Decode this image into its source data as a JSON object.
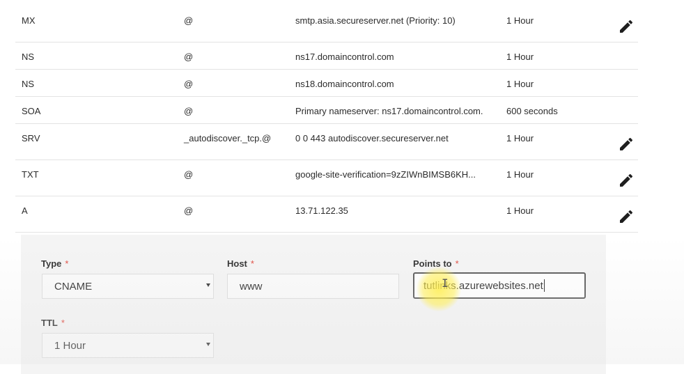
{
  "records": [
    {
      "type": "MX",
      "name": "@",
      "value": "smtp.asia.secureserver.net (Priority: 10)",
      "ttl": "1 Hour",
      "editable": true
    },
    {
      "type": "NS",
      "name": "@",
      "value": "ns17.domaincontrol.com",
      "ttl": "1 Hour",
      "editable": false
    },
    {
      "type": "NS",
      "name": "@",
      "value": "ns18.domaincontrol.com",
      "ttl": "1 Hour",
      "editable": false
    },
    {
      "type": "SOA",
      "name": "@",
      "value": "Primary nameserver: ns17.domaincontrol.com.",
      "ttl": "600 seconds",
      "editable": false
    },
    {
      "type": "SRV",
      "name": "_autodiscover._tcp.@",
      "value": "0 0 443 autodiscover.secureserver.net",
      "ttl": "1 Hour",
      "editable": true
    },
    {
      "type": "TXT",
      "name": "@",
      "value": "google-site-verification=9zZIWnBIMSB6KH...",
      "ttl": "1 Hour",
      "editable": true
    },
    {
      "type": "A",
      "name": "@",
      "value": "13.71.122.35",
      "ttl": "1 Hour",
      "editable": true
    }
  ],
  "form": {
    "type_label": "Type",
    "type_value": "CNAME",
    "host_label": "Host",
    "host_value": "www",
    "points_label": "Points to",
    "points_value": "tutlinks.azurewebsites.net",
    "ttl_label": "TTL",
    "ttl_value": "1 Hour",
    "required_mark": "*"
  },
  "icons": {
    "edit": "pencil-icon",
    "select": "chevron-down-icon"
  },
  "colors": {
    "required": "#e0483d",
    "highlight": "#ffee50"
  }
}
